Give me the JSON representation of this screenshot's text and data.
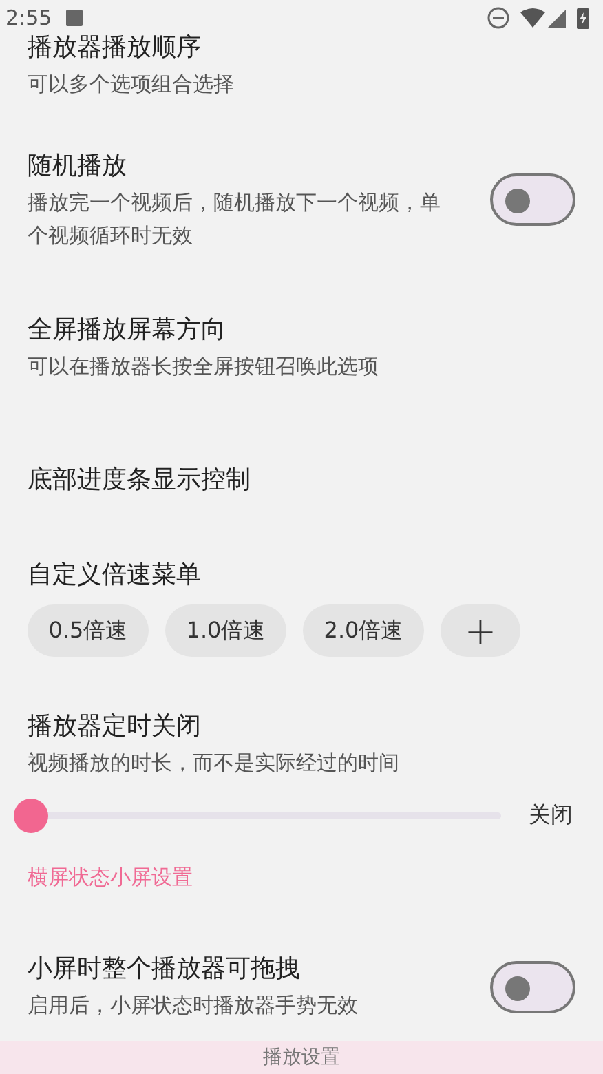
{
  "status_bar": {
    "time": "2:55"
  },
  "items": [
    {
      "kind": "text",
      "title": "播放器播放顺序",
      "subtitle": "可以多个选项组合选择"
    },
    {
      "kind": "switch",
      "title": "随机播放",
      "subtitle": "播放完一个视频后，随机播放下一个视频，单个视频循环时无效",
      "on": false
    },
    {
      "kind": "text",
      "title": "全屏播放屏幕方向",
      "subtitle": "可以在播放器长按全屏按钮召唤此选项"
    },
    {
      "kind": "text",
      "title": "底部进度条显示控制"
    },
    {
      "kind": "chips",
      "title": "自定义倍速菜单",
      "chips": [
        "0.5倍速",
        "1.0倍速",
        "2.0倍速"
      ],
      "add": "+"
    },
    {
      "kind": "slider",
      "title": "播放器定时关闭",
      "subtitle": "视频播放的时长，而不是实际经过的时间",
      "level": 0,
      "reading": "关闭"
    },
    {
      "kind": "header",
      "title": "横屏状态小屏设置"
    },
    {
      "kind": "switch",
      "title": "小屏时整个播放器可拖拽",
      "subtitle": "启用后，小屏状态时播放器手势无效",
      "on": false
    }
  ],
  "bottom_bar": {
    "title": "播放设置"
  }
}
